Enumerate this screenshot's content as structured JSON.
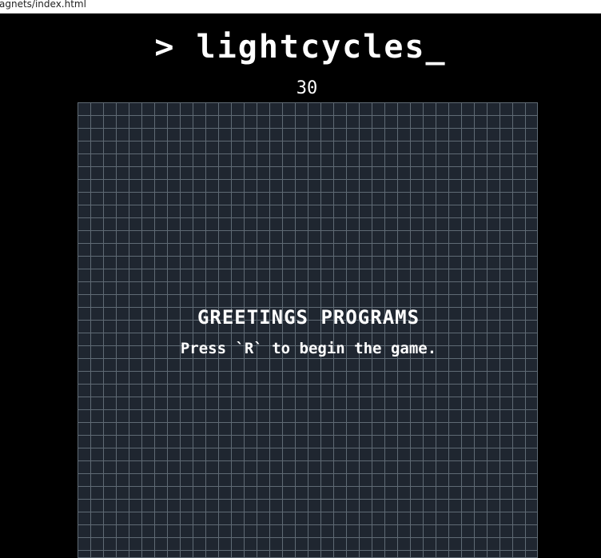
{
  "browser": {
    "url_fragment": "agnets/index.html"
  },
  "game": {
    "title": "> lightcycles_",
    "score": "30",
    "message_title": "GREETINGS PROGRAMS",
    "message_subtitle": "Press `R` to begin the game."
  },
  "colors": {
    "background": "#000000",
    "board": "#1f2630",
    "grid_lines": "#5f6a74",
    "text": "#ffffff"
  }
}
